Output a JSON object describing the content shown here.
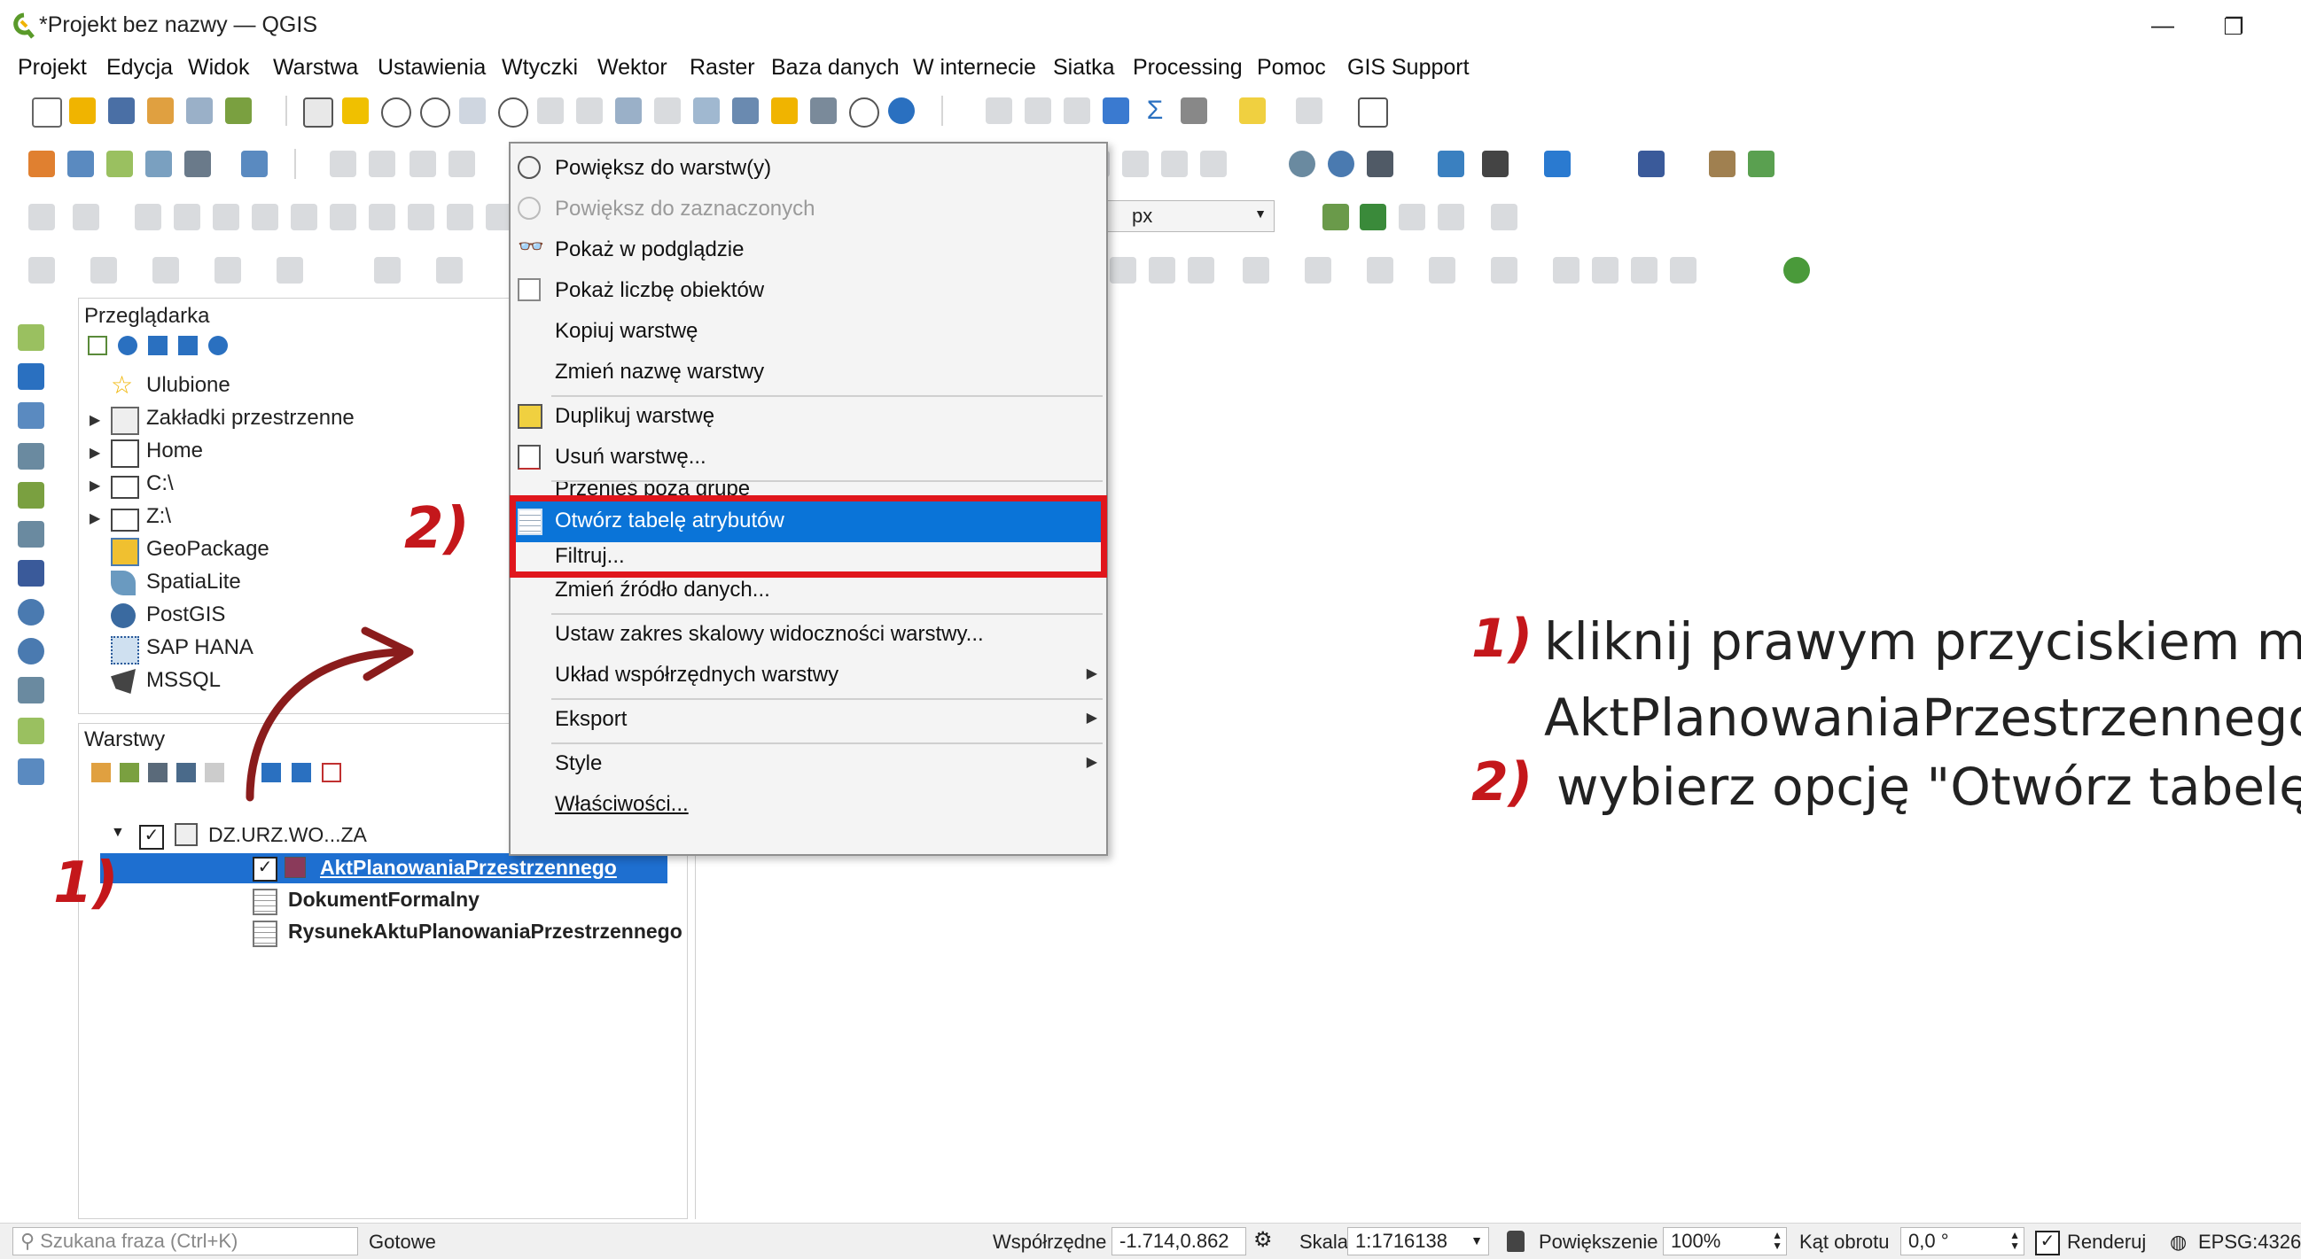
{
  "window": {
    "title": "*Projekt bez nazwy — QGIS",
    "minimize": "—",
    "maximize": "❐"
  },
  "menu": [
    "Projekt",
    "Edycja",
    "Widok",
    "Warstwa",
    "Ustawienia",
    "Wtyczki",
    "Wektor",
    "Raster",
    "Baza danych",
    "W internecie",
    "Siatka",
    "Processing",
    "Pomoc",
    "GIS Support"
  ],
  "toolbar": {
    "units_value": "px"
  },
  "browser": {
    "title": "Przeglądarka",
    "items": [
      {
        "label": "Ulubione",
        "icon": "star-icon",
        "expandable": false
      },
      {
        "label": "Zakładki przestrzenne",
        "icon": "bookmarks-icon",
        "expandable": true
      },
      {
        "label": "Home",
        "icon": "home-icon",
        "expandable": true
      },
      {
        "label": "C:\\",
        "icon": "folder-icon",
        "expandable": true
      },
      {
        "label": "Z:\\",
        "icon": "folder-icon",
        "expandable": true
      },
      {
        "label": "GeoPackage",
        "icon": "geopackage-icon",
        "expandable": false
      },
      {
        "label": "SpatiaLite",
        "icon": "spatialite-icon",
        "expandable": false
      },
      {
        "label": "PostGIS",
        "icon": "postgis-icon",
        "expandable": false
      },
      {
        "label": "SAP HANA",
        "icon": "sap-hana-icon",
        "expandable": false
      },
      {
        "label": "MSSQL",
        "icon": "mssql-icon",
        "expandable": false
      }
    ]
  },
  "layers": {
    "title": "Warstwy",
    "group": "DZ.URZ.WO...ZA",
    "items": [
      {
        "label": "AktPlanowaniaPrzestrzennego",
        "selected": true
      },
      {
        "label": "DokumentFormalny",
        "selected": false
      },
      {
        "label": "RysunekAktuPlanowaniaPrzestrzennego",
        "selected": false
      }
    ]
  },
  "context_menu": {
    "items": [
      {
        "label": "Powiększ do warstw(y)",
        "icon": "zoom-layer-icon",
        "disabled": false
      },
      {
        "label": "Powiększ do zaznaczonych",
        "icon": "zoom-selected-icon",
        "disabled": true
      },
      {
        "label": "Pokaż w podglądzie",
        "icon": "overview-icon",
        "disabled": false
      },
      {
        "label": "Pokaż liczbę obiektów",
        "icon": "checkbox-icon",
        "disabled": false
      },
      {
        "label": "Kopiuj warstwę",
        "icon": "",
        "disabled": false
      },
      {
        "label": "Zmień nazwę warstwy",
        "icon": "",
        "disabled": false
      },
      {
        "label": "Duplikuj warstwę",
        "icon": "duplicate-icon",
        "disabled": false
      },
      {
        "label": "Usuń warstwę...",
        "icon": "remove-layer-icon",
        "disabled": false
      },
      {
        "label": "Przenieś poza grupę",
        "icon": "",
        "disabled": false
      },
      {
        "label": "Otwórz tabelę atrybutów",
        "icon": "attribute-table-icon",
        "disabled": false,
        "selected": true
      },
      {
        "label": "Filtruj...",
        "icon": "",
        "disabled": false
      },
      {
        "label": "Zmień źródło danych...",
        "icon": "",
        "disabled": false
      },
      {
        "label": "Ustaw zakres skalowy widoczności warstwy...",
        "icon": "",
        "disabled": false
      },
      {
        "label": "Układ współrzędnych warstwy",
        "icon": "",
        "disabled": false,
        "submenu": true
      },
      {
        "label": "Eksport",
        "icon": "",
        "disabled": false,
        "submenu": true
      },
      {
        "label": "Style",
        "icon": "",
        "disabled": false,
        "submenu": true
      },
      {
        "label": "Właściwości...",
        "icon": "",
        "disabled": false
      }
    ]
  },
  "statusbar": {
    "search_placeholder": "Szukana fraza (Ctrl+K)",
    "status": "Gotowe",
    "coords_label": "Współrzędne",
    "coords_value": "-1.714,0.862",
    "scale_label": "Skala",
    "scale_value": "1:1716138",
    "magnify_label": "Powiększenie",
    "magnify_value": "100%",
    "rotation_label": "Kąt obrotu",
    "rotation_value": "0,0 °",
    "render_label": "Renderuj",
    "crs": "EPSG:4326"
  },
  "annotations": {
    "step1_num": "1)",
    "step2_num": "2)",
    "line1": "kliknij prawym przyciskiem my",
    "line2": "AktPlanowaniaPrzestrzennego",
    "line3": "wybierz opcję \"Otwórz tabelę"
  },
  "colors": {
    "accent_red": "#c4171b",
    "highlight_red": "#e0161c",
    "selection_blue": "#0a74d8",
    "layer_selection": "#1e6fd0"
  }
}
